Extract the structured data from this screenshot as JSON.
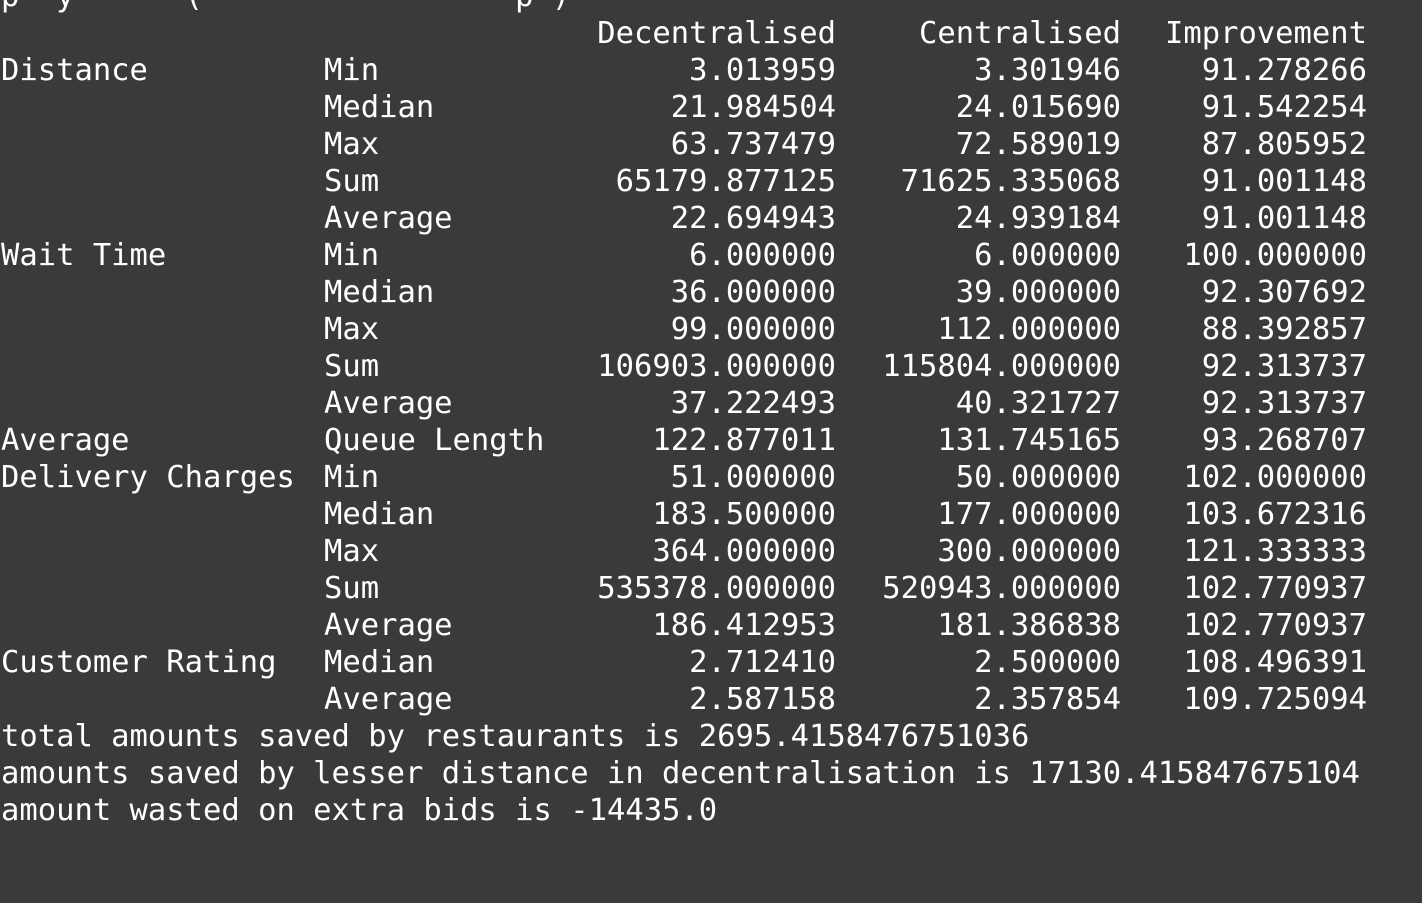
{
  "header": {
    "partial_line": "p  y      (                 p )",
    "columns": [
      "Decentralised",
      "Centralised",
      "Improvement"
    ]
  },
  "rows": [
    {
      "group": "Distance",
      "stat": "Min",
      "dec": "3.013959",
      "cen": "3.301946",
      "imp": "91.278266"
    },
    {
      "group": "",
      "stat": "Median",
      "dec": "21.984504",
      "cen": "24.015690",
      "imp": "91.542254"
    },
    {
      "group": "",
      "stat": "Max",
      "dec": "63.737479",
      "cen": "72.589019",
      "imp": "87.805952"
    },
    {
      "group": "",
      "stat": "Sum",
      "dec": "65179.877125",
      "cen": "71625.335068",
      "imp": "91.001148"
    },
    {
      "group": "",
      "stat": "Average",
      "dec": "22.694943",
      "cen": "24.939184",
      "imp": "91.001148"
    },
    {
      "group": "Wait Time",
      "stat": "Min",
      "dec": "6.000000",
      "cen": "6.000000",
      "imp": "100.000000"
    },
    {
      "group": "",
      "stat": "Median",
      "dec": "36.000000",
      "cen": "39.000000",
      "imp": "92.307692"
    },
    {
      "group": "",
      "stat": "Max",
      "dec": "99.000000",
      "cen": "112.000000",
      "imp": "88.392857"
    },
    {
      "group": "",
      "stat": "Sum",
      "dec": "106903.000000",
      "cen": "115804.000000",
      "imp": "92.313737"
    },
    {
      "group": "",
      "stat": "Average",
      "dec": "37.222493",
      "cen": "40.321727",
      "imp": "92.313737"
    },
    {
      "group": "Average",
      "stat": "Queue Length",
      "dec": "122.877011",
      "cen": "131.745165",
      "imp": "93.268707"
    },
    {
      "group": "Delivery Charges",
      "stat": "Min",
      "dec": "51.000000",
      "cen": "50.000000",
      "imp": "102.000000"
    },
    {
      "group": "",
      "stat": "Median",
      "dec": "183.500000",
      "cen": "177.000000",
      "imp": "103.672316"
    },
    {
      "group": "",
      "stat": "Max",
      "dec": "364.000000",
      "cen": "300.000000",
      "imp": "121.333333"
    },
    {
      "group": "",
      "stat": "Sum",
      "dec": "535378.000000",
      "cen": "520943.000000",
      "imp": "102.770937"
    },
    {
      "group": "",
      "stat": "Average",
      "dec": "186.412953",
      "cen": "181.386838",
      "imp": "102.770937"
    },
    {
      "group": "Customer Rating",
      "stat": "Median",
      "dec": "2.712410",
      "cen": "2.500000",
      "imp": "108.496391"
    },
    {
      "group": "",
      "stat": "Average",
      "dec": "2.587158",
      "cen": "2.357854",
      "imp": "109.725094"
    }
  ],
  "messages": [
    "total amounts saved by restaurants is 2695.4158476751036",
    "amounts saved by lesser distance in decentralisation is 17130.415847675104",
    "amount wasted on extra bids is -14435.0"
  ]
}
